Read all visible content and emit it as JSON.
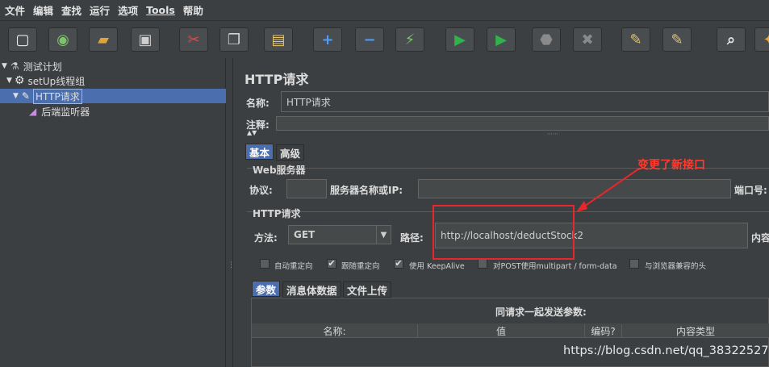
{
  "menu": [
    "文件",
    "编辑",
    "查找",
    "运行",
    "选项",
    "Tools",
    "帮助"
  ],
  "toolbar_buttons": [
    {
      "name": "new-icon",
      "glyph": "▢",
      "color": "#f2f2f2"
    },
    {
      "name": "templates-icon",
      "glyph": "◉",
      "color": "#7dc36b"
    },
    {
      "name": "open-icon",
      "glyph": "▰",
      "color": "#e0a43b"
    },
    {
      "name": "save-icon",
      "glyph": "▣",
      "color": "#cfcfcf"
    },
    {
      "name": "cut-icon",
      "glyph": "✂",
      "color": "#e04848"
    },
    {
      "name": "copy-icon",
      "glyph": "❐",
      "color": "#d5d5d5"
    },
    {
      "name": "paste-icon",
      "glyph": "▤",
      "color": "#e8c46a"
    },
    {
      "name": "expand-icon",
      "glyph": "+",
      "color": "#4a9eff"
    },
    {
      "name": "collapse-icon",
      "glyph": "−",
      "color": "#4a9eff"
    },
    {
      "name": "toggle-icon",
      "glyph": "⚡",
      "color": "#7dc36b"
    },
    {
      "name": "start-icon",
      "glyph": "▶",
      "color": "#2fb34a"
    },
    {
      "name": "start-no-pauses-icon",
      "glyph": "▶",
      "color": "#2fb34a"
    },
    {
      "name": "stop-icon",
      "glyph": "⬣",
      "color": "#8a8a8a"
    },
    {
      "name": "shutdown-icon",
      "glyph": "✖",
      "color": "#8a8a8a"
    },
    {
      "name": "clear-icon",
      "glyph": "✎",
      "color": "#d8c27a"
    },
    {
      "name": "clear-all-icon",
      "glyph": "✎",
      "color": "#d8c27a"
    },
    {
      "name": "search-icon",
      "glyph": "⌕",
      "color": "#e6e6e6"
    },
    {
      "name": "reset-search-icon",
      "glyph": "✦",
      "color": "#e8a23b"
    }
  ],
  "tree": {
    "root": "测试计划",
    "threadgroup": "setUp线程组",
    "sampler": "HTTP请求",
    "listener": "后端监听器"
  },
  "panel": {
    "title": "HTTP请求",
    "name_label": "名称:",
    "name_value": "HTTP请求",
    "comment_label": "注释:",
    "tabs": [
      "基本",
      "高级"
    ],
    "web_server": "Web服务器",
    "protocol_label": "协议:",
    "server_label": "服务器名称或IP:",
    "port_label": "端口号:",
    "http_request_group": "HTTP请求",
    "method_label": "方法:",
    "method_value": "GET",
    "path_label": "路径:",
    "path_value": "http://localhost/deductStock2",
    "content_label": "内容",
    "checkboxes": [
      {
        "label": "自动重定向",
        "checked": false
      },
      {
        "label": "跟随重定向",
        "checked": true
      },
      {
        "label": "使用 KeepAlive",
        "checked": true
      },
      {
        "label": "对POST使用multipart / form-data",
        "checked": false
      },
      {
        "label": "与浏览器兼容的头",
        "checked": false
      }
    ],
    "subtabs": [
      "参数",
      "消息体数据",
      "文件上传"
    ],
    "params_title": "同请求一起发送参数:",
    "columns": [
      "名称:",
      "值",
      "编码?",
      "内容类型"
    ]
  },
  "annotation": "变更了新接口",
  "watermark": "https://blog.csdn.net/qq_38322527",
  "colors": {
    "accent": "#4b6eaf",
    "annotation": "#e8262b"
  }
}
